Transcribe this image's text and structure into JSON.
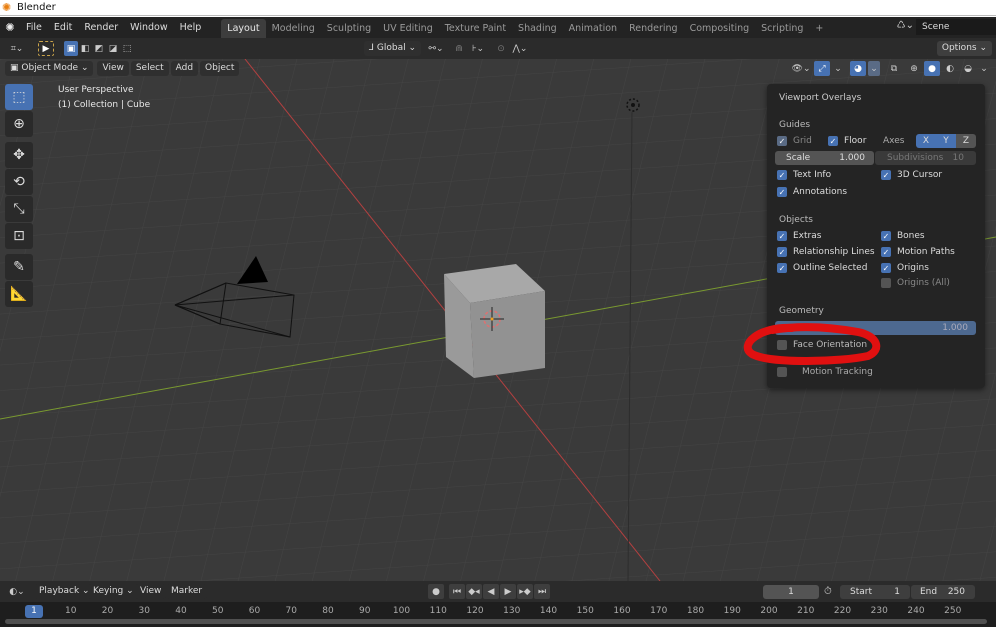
{
  "window": {
    "title": "Blender"
  },
  "menubar": {
    "items": [
      "File",
      "Edit",
      "Render",
      "Window",
      "Help"
    ]
  },
  "workspaces": {
    "tabs": [
      "Layout",
      "Modeling",
      "Sculpting",
      "UV Editing",
      "Texture Paint",
      "Shading",
      "Animation",
      "Rendering",
      "Compositing",
      "Scripting"
    ],
    "active": "Layout",
    "add_label": "+"
  },
  "scene": {
    "name": "Scene"
  },
  "tool_header": {
    "orientation": "Global",
    "options_label": "Options"
  },
  "viewport_header": {
    "mode": "Object Mode",
    "menus": [
      "View",
      "Select",
      "Add",
      "Object"
    ]
  },
  "viewport": {
    "view_name": "User Perspective",
    "collection_info": "(1) Collection | Cube"
  },
  "overlays": {
    "title": "Viewport Overlays",
    "guides_label": "Guides",
    "grid_label": "Grid",
    "grid_checked": true,
    "floor_label": "Floor",
    "floor_checked": true,
    "axes_label": "Axes",
    "axes": [
      "X",
      "Y",
      "Z"
    ],
    "axes_active": [
      "X",
      "Y"
    ],
    "scale_label": "Scale",
    "scale_value": "1.000",
    "subdivisions_label": "Subdivisions",
    "subdivisions_value": "10",
    "text_info_label": "Text Info",
    "text_info_checked": true,
    "cursor_label": "3D Cursor",
    "cursor_checked": true,
    "annotations_label": "Annotations",
    "annotations_checked": true,
    "objects_label": "Objects",
    "extras_label": "Extras",
    "extras_checked": true,
    "bones_label": "Bones",
    "bones_checked": true,
    "relationship_label": "Relationship Lines",
    "relationship_checked": true,
    "motion_paths_label": "Motion Paths",
    "motion_paths_checked": true,
    "outline_label": "Outline Selected",
    "outline_checked": true,
    "origins_label": "Origins",
    "origins_checked": true,
    "origins_all_label": "Origins (All)",
    "origins_all_checked": false,
    "geometry_label": "Geometry",
    "wireframe_value": "1.000",
    "face_orientation_label": "Face Orientation",
    "face_orientation_checked": false,
    "motion_tracking_label": "Motion Tracking",
    "motion_tracking_checked": false
  },
  "timeline": {
    "menus": [
      "Playback",
      "Keying",
      "View",
      "Marker"
    ],
    "current_frame": "1",
    "start_label": "Start",
    "start_value": "1",
    "end_label": "End",
    "end_value": "250",
    "ticks": [
      "10",
      "20",
      "30",
      "40",
      "50",
      "60",
      "70",
      "80",
      "90",
      "100",
      "110",
      "120",
      "130",
      "140",
      "150",
      "160",
      "170",
      "180",
      "190",
      "200",
      "210",
      "220",
      "230",
      "240",
      "250"
    ],
    "playhead": "1"
  },
  "colors": {
    "accent": "#4772b3",
    "annotation": "#e01010",
    "x_axis": "#b34040",
    "y_axis": "#7a9a30"
  }
}
